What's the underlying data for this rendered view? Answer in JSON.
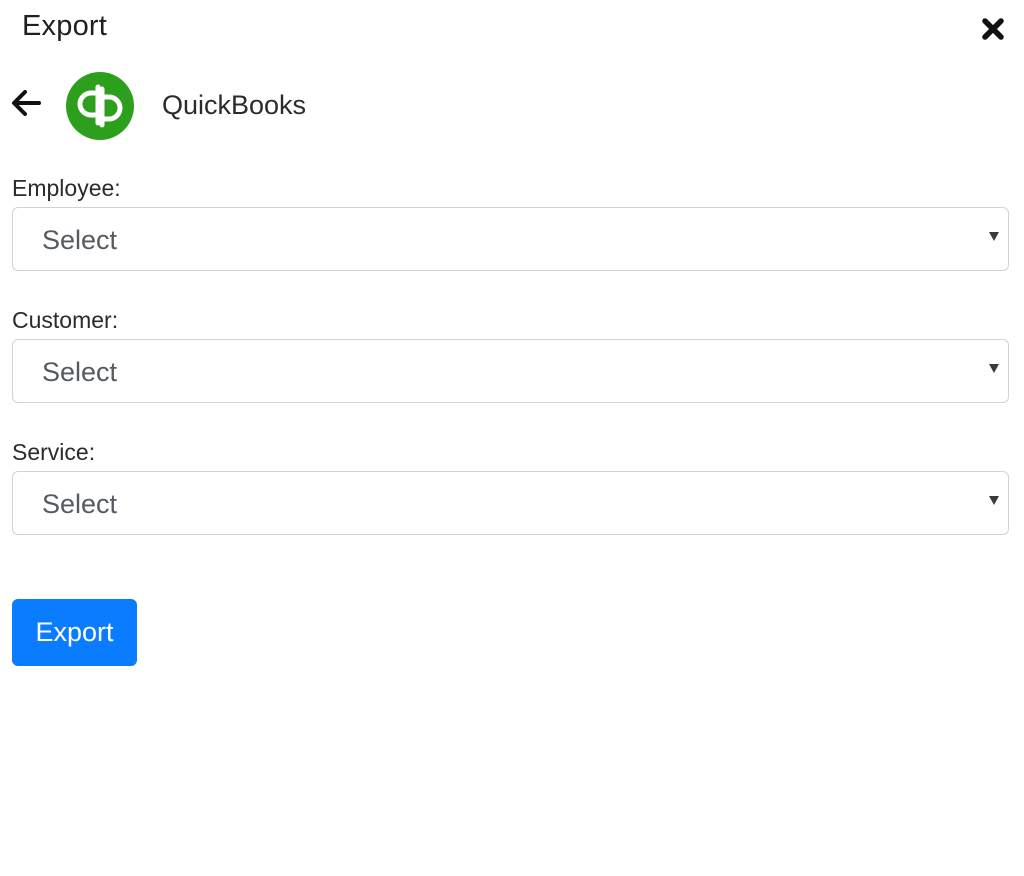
{
  "dialog": {
    "title": "Export"
  },
  "provider": {
    "name": "QuickBooks",
    "logo_icon": "quickbooks-logo",
    "logo_color": "#2ca01c"
  },
  "fields": [
    {
      "label": "Employee:",
      "value": "Select"
    },
    {
      "label": "Customer:",
      "value": "Select"
    },
    {
      "label": "Service:",
      "value": "Select"
    }
  ],
  "actions": {
    "export_label": "Export",
    "accent_color": "#0a7cff"
  },
  "icons": {
    "close": "close-icon",
    "back": "arrow-left-icon",
    "dropdown": "chevron-down-icon"
  }
}
